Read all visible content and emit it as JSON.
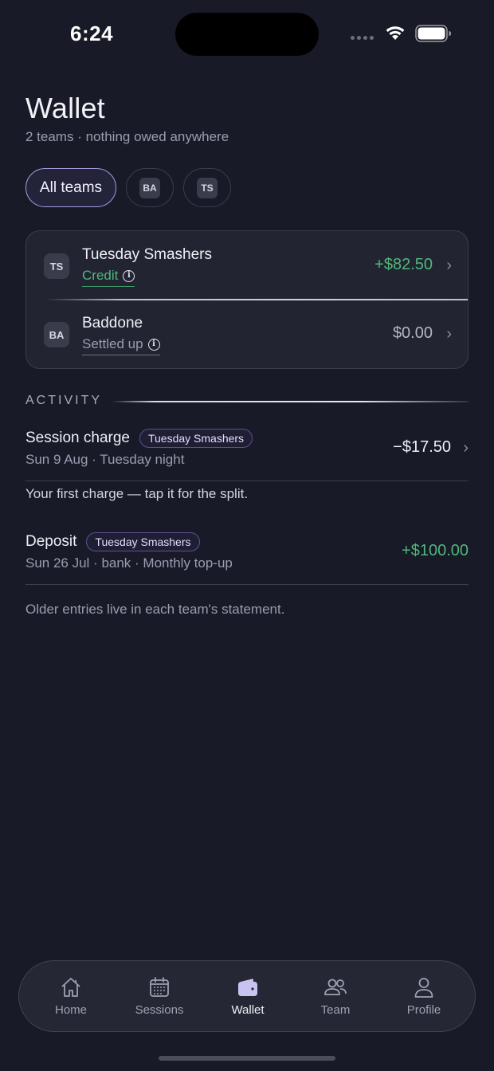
{
  "status_bar": {
    "time": "6:24"
  },
  "header": {
    "title": "Wallet",
    "subtitle": "2 teams · nothing owed anywhere"
  },
  "filters": {
    "all_label": "All teams",
    "team_chips": [
      "BA",
      "TS"
    ]
  },
  "teams": [
    {
      "initials": "TS",
      "name": "Tuesday Smashers",
      "status": "Credit",
      "amount": "+$82.50"
    },
    {
      "initials": "BA",
      "name": "Baddone",
      "status": "Settled up",
      "amount": "$0.00"
    }
  ],
  "activity": {
    "header": "ACTIVITY",
    "items": [
      {
        "title": "Session charge",
        "team": "Tuesday Smashers",
        "sub": "Sun 9 Aug · Tuesday night",
        "amount": "−$17.50"
      },
      {
        "title": "Deposit",
        "team": "Tuesday Smashers",
        "sub": "Sun 26 Jul · bank · Monthly top-up",
        "amount": "+$100.00"
      }
    ],
    "hint": "Your first charge — tap it for the split.",
    "footer": "Older entries live in each team's statement."
  },
  "tabbar": {
    "tabs": [
      {
        "label": "Home",
        "icon": "home-icon"
      },
      {
        "label": "Sessions",
        "icon": "calendar-icon"
      },
      {
        "label": "Wallet",
        "icon": "wallet-icon",
        "active": true
      },
      {
        "label": "Team",
        "icon": "team-icon"
      },
      {
        "label": "Profile",
        "icon": "profile-icon"
      }
    ]
  },
  "colors": {
    "background": "#181a27",
    "accent": "#a99be0",
    "positive": "#4fb87a",
    "card": "#222431"
  }
}
